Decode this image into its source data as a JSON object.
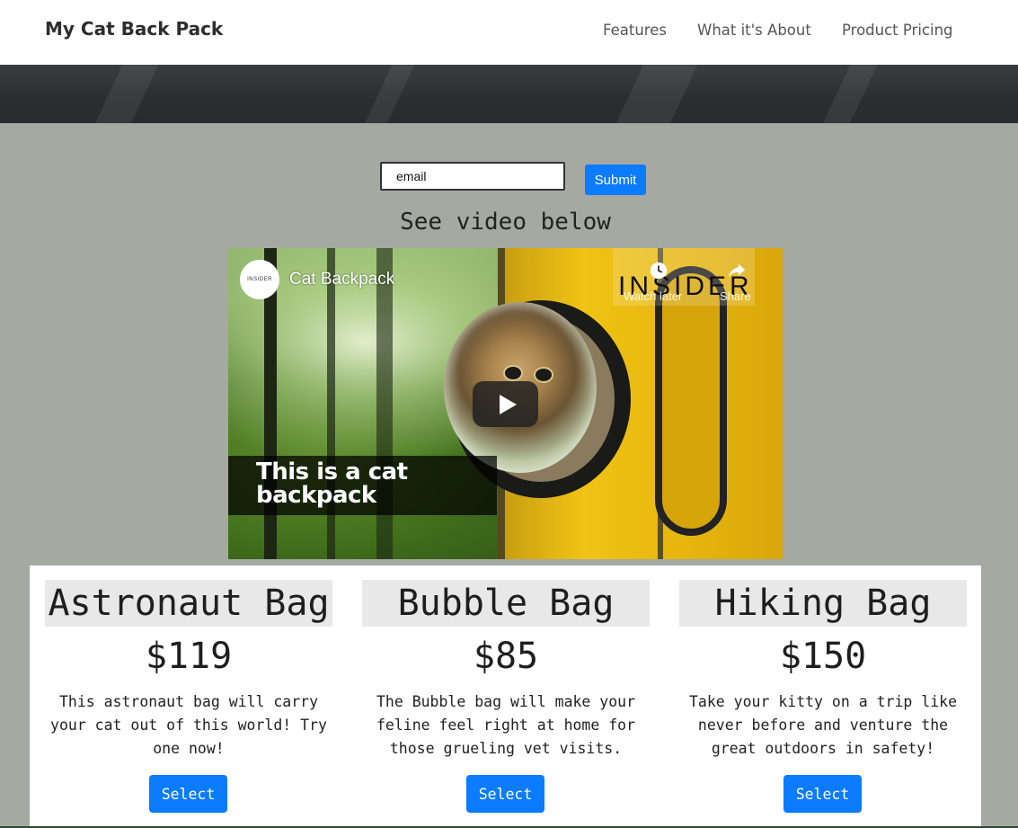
{
  "navbar": {
    "brand": "My Cat Back Pack",
    "links": [
      {
        "label": "Features"
      },
      {
        "label": "What it's About"
      },
      {
        "label": "Product Pricing"
      }
    ]
  },
  "form": {
    "email_value": "email",
    "submit_label": "Submit"
  },
  "video_heading": "See video below",
  "video": {
    "title": "Cat Backpack",
    "channel_logo_text": "INSIDER",
    "watermark": "INSIDER",
    "watch_later_label": "Watch later",
    "share_label": "Share",
    "caption": "This is a cat backpack",
    "play_icon": "play-icon"
  },
  "products": [
    {
      "name": "Astronaut Bag",
      "price": "$119",
      "description": "This astronaut bag will carry your cat out of this world! Try one now!",
      "button_label": "Select"
    },
    {
      "name": "Bubble Bag",
      "price": "$85",
      "description": "The Bubble bag will make your feline feel right at home for those grueling vet visits.",
      "button_label": "Select"
    },
    {
      "name": "Hiking Bag",
      "price": "$150",
      "description": "Take your kitty on a trip like never before and venture the great outdoors in safety!",
      "button_label": "Select"
    }
  ],
  "colors": {
    "page_bg": "#a6a8a2",
    "accent_blue": "#0b7bff",
    "hero_dark": "#2c2d30",
    "card_title_bg": "#e8e8e8"
  }
}
